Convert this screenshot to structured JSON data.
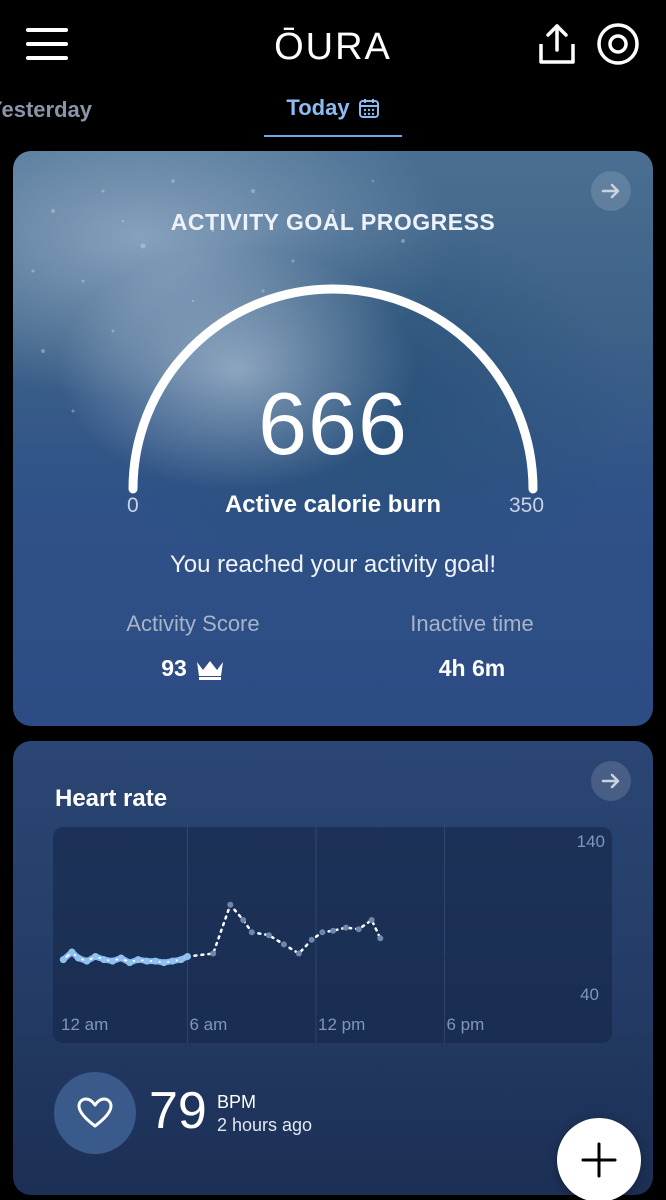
{
  "header": {
    "logo": "ŌURA",
    "menu_icon": "hamburger-menu-icon",
    "share_icon": "share-upload-icon",
    "ring_icon": "ring-icon"
  },
  "tabs": {
    "previous_label": "Yesterday",
    "current_label": "Today",
    "current_icon": "calendar-icon"
  },
  "activity": {
    "title": "ACTIVITY GOAL PROGRESS",
    "value": "666",
    "gauge_min": "0",
    "gauge_max": "350",
    "progress_fraction": 1.0,
    "gauge_label": "Active calorie burn",
    "message": "You reached your activity goal!",
    "score_label": "Activity Score",
    "score_value": "93",
    "score_icon": "crown-icon",
    "inactive_label": "Inactive time",
    "inactive_value": "4h 6m"
  },
  "heart_rate": {
    "title": "Heart rate",
    "y_top": "140",
    "y_bottom": "40",
    "x_labels": [
      "12 am",
      "6 am",
      "12 pm",
      "6 pm"
    ],
    "current_bpm": "79",
    "unit": "BPM",
    "time_ago": "2 hours ago",
    "icon": "heart-icon"
  },
  "chart_data": {
    "type": "line",
    "title": "Heart rate",
    "xlabel": "",
    "ylabel": "",
    "ylim": [
      40,
      140
    ],
    "xlim": [
      0,
      24
    ],
    "x_ticks": [
      "12 am",
      "6 am",
      "12 pm",
      "6 pm"
    ],
    "series": [
      {
        "x": [
          0.2,
          0.6,
          0.9,
          1.3,
          1.7,
          2.1,
          2.5,
          2.9,
          3.3,
          3.7,
          4.1,
          4.5,
          4.9,
          5.3,
          5.7,
          6.0,
          7.2,
          8.0,
          8.6,
          9.0,
          9.8,
          10.5,
          11.2,
          11.8,
          12.3,
          12.8,
          13.4,
          14.0,
          14.6,
          15.0
        ],
        "y": [
          62,
          67,
          63,
          61,
          64,
          62,
          61,
          63,
          60,
          62,
          61,
          61,
          60,
          61,
          62,
          64,
          66,
          98,
          88,
          80,
          78,
          72,
          66,
          75,
          80,
          81,
          83,
          82,
          88,
          76
        ]
      }
    ],
    "grid": true,
    "legend": "none"
  },
  "fab": {
    "icon": "plus-icon"
  }
}
